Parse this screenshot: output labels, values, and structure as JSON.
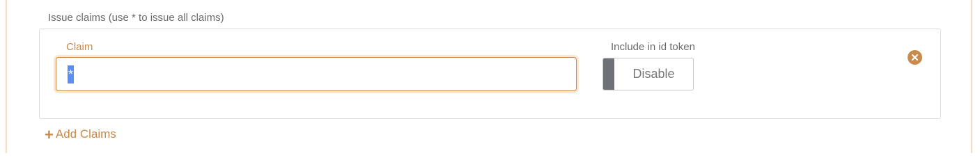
{
  "section": {
    "label": "Issue claims (use * to issue all claims)"
  },
  "claim_row": {
    "claim_label": "Claim",
    "claim_value": "*",
    "toggle_label": "Include in id token",
    "toggle_state": "Disable"
  },
  "actions": {
    "add_label": "Add Claims",
    "add_icon": "plus-icon",
    "remove_icon": "close-circle-icon"
  },
  "colors": {
    "accent": "#c98a4b",
    "selection": "#5b8ef3",
    "toggle_knob": "#6d7178"
  }
}
